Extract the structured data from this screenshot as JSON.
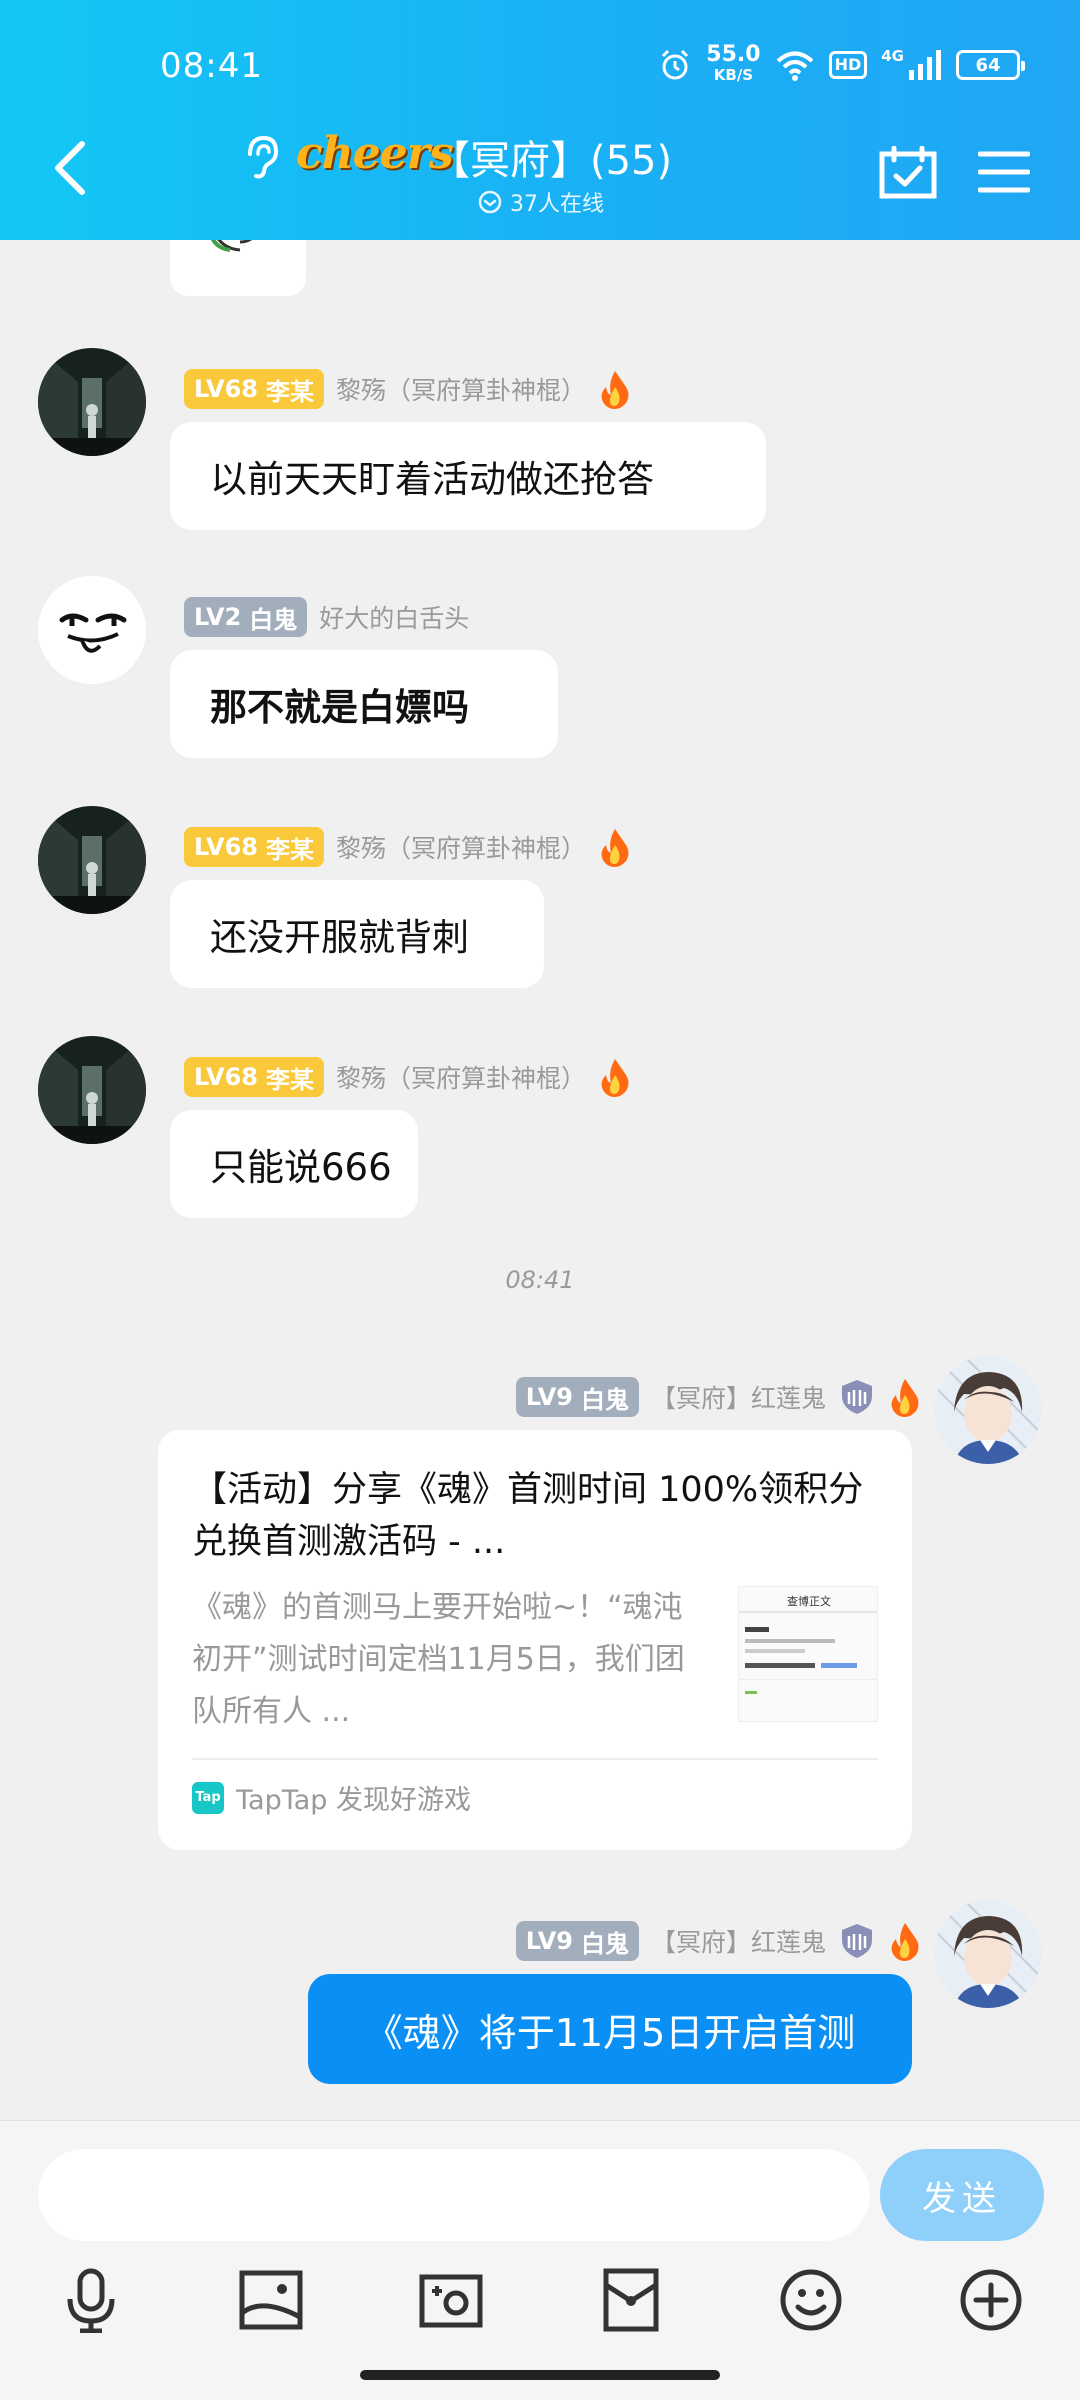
{
  "status_bar": {
    "time": "08:41",
    "speed_value": "55.0",
    "speed_unit": "KB/S",
    "hd": "HD",
    "network": "4G",
    "battery": "64"
  },
  "header": {
    "brand": "cheers",
    "group_name": "【冥府】(55)",
    "online_text": "37人在线"
  },
  "messages": [
    {
      "level": "LV68",
      "rank": "李某",
      "nick": "黎殇（冥府算卦神棍）",
      "text": "以前天天盯着活动做还抢答"
    },
    {
      "level": "LV2",
      "rank": "白鬼",
      "nick": "好大的白舌头",
      "text": "那不就是白嫖吗"
    },
    {
      "level": "LV68",
      "rank": "李某",
      "nick": "黎殇（冥府算卦神棍）",
      "text": "还没开服就背刺"
    },
    {
      "level": "LV68",
      "rank": "李某",
      "nick": "黎殇（冥府算卦神棍）",
      "text": "只能说666"
    }
  ],
  "timestamp": "08:41",
  "self_messages": [
    {
      "level": "LV9",
      "rank": "白鬼",
      "nick": "【冥府】红莲鬼",
      "card": {
        "title": "【活动】分享《魂》首测时间 100%领积分兑换首测激活码 - ...",
        "description": "《魂》的首测马上要开始啦~！“魂沌初开”测试时间定档11月5日，我们团队所有人 ...",
        "thumb_title": "查博正文",
        "source": "TapTap 发现好游戏",
        "source_logo": "Tap"
      }
    },
    {
      "level": "LV9",
      "rank": "白鬼",
      "nick": "【冥府】红莲鬼",
      "text": "《魂》将于11月5日开启首测"
    }
  ],
  "input": {
    "placeholder": "",
    "send_label": "发送"
  },
  "toolbar": [
    "microphone-icon",
    "image-icon",
    "camera-icon",
    "red-packet-icon",
    "emoji-icon",
    "plus-icon"
  ],
  "colors": {
    "header": "#1ab0f5",
    "level_gold": "#f9c93b",
    "level_gray": "#a3aebd",
    "self_bubble": "#0a8ff5",
    "send_button": "#8fd0fa"
  }
}
